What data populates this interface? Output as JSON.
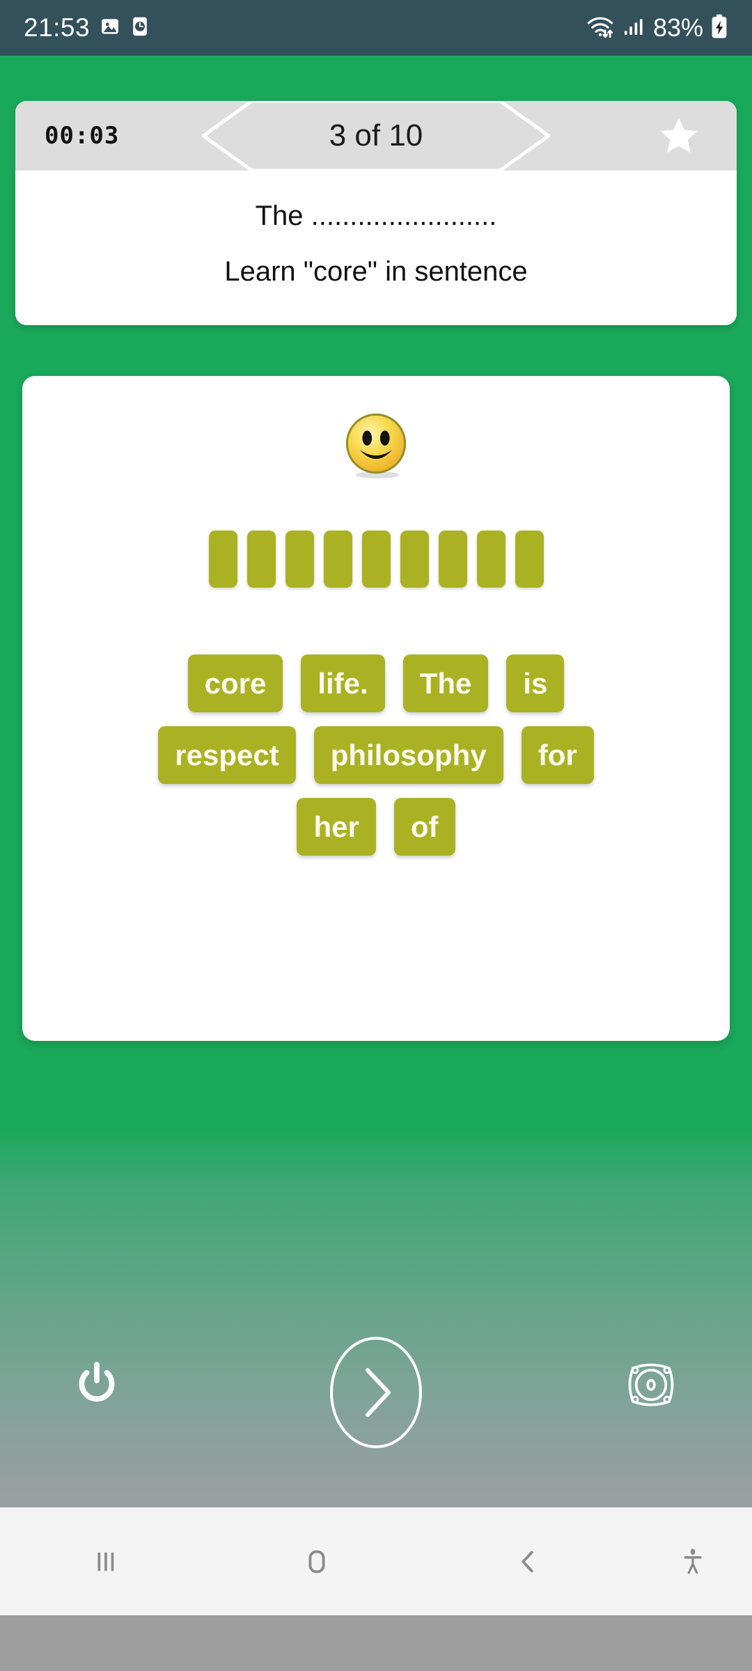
{
  "status_bar": {
    "time": "21:53",
    "battery_percent": "83%",
    "icons": [
      "image-icon",
      "clock-icon",
      "wifi-icon",
      "signal-icon",
      "battery-charging-icon"
    ],
    "background_color": "#33505b"
  },
  "header": {
    "timer": "00:03",
    "progress_label": "3 of 10",
    "star_icon": "star-icon",
    "bar_color": "#dddddd"
  },
  "question": {
    "prompt_line": "The ........................",
    "instruction_line": "Learn \"core\" in sentence"
  },
  "game": {
    "mascot_icon": "smiley-face-icon",
    "slot_count": 9,
    "tile_color": "#aab223",
    "tile_text_color": "#fdfbee",
    "word_rows": [
      [
        "core",
        "life.",
        "The",
        "is"
      ],
      [
        "respect",
        "philosophy",
        "for"
      ],
      [
        "her",
        "of"
      ]
    ]
  },
  "controls": {
    "power_label": "power-icon",
    "next_label": "next-arrow-icon",
    "speaker_label": "speaker-icon"
  },
  "nav_bar": {
    "recents_label": "recents-icon",
    "home_label": "home-icon",
    "back_label": "back-icon",
    "accessibility_label": "accessibility-icon"
  },
  "theme": {
    "background_green": "#1aa85a",
    "card_white": "#ffffff",
    "accent_olive": "#aab223"
  }
}
